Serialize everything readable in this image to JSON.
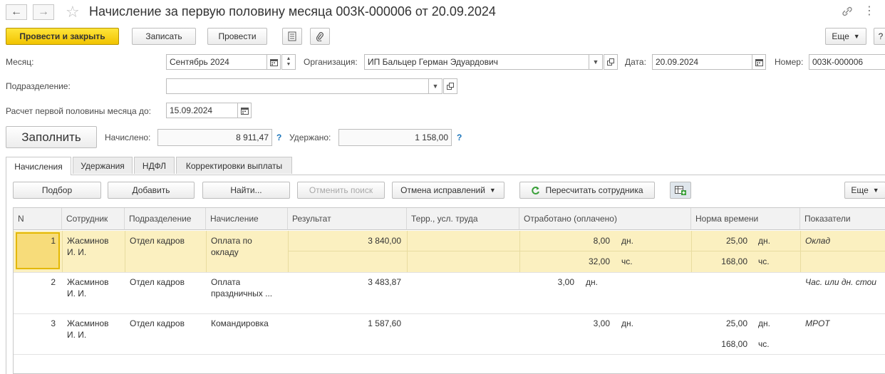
{
  "header": {
    "title": "Начисление за первую половину месяца 003К-000006 от 20.09.2024",
    "nav_back": "←",
    "nav_forward": "→",
    "star": "☆",
    "link": "🔗",
    "more_vert": "⋮"
  },
  "toolbar": {
    "post_close": "Провести и закрыть",
    "save": "Записать",
    "post": "Провести",
    "more": "Еще",
    "help": "?"
  },
  "form": {
    "month_label": "Месяц:",
    "month_value": "Сентябрь 2024",
    "org_label": "Организация:",
    "org_value": "ИП Бальцер Герман Эдуардович",
    "date_label": "Дата:",
    "date_value": "20.09.2024",
    "number_label": "Номер:",
    "number_value": "003К-000006",
    "dept_label": "Подразделение:",
    "dept_value": "",
    "calc_until_label": "Расчет первой половины месяца до:",
    "calc_until_value": "15.09.2024",
    "fill_button": "Заполнить",
    "accrued_label": "Начислено:",
    "accrued_value": "8 911,47",
    "withheld_label": "Удержано:",
    "withheld_value": "1 158,00",
    "help_mark": "?"
  },
  "tabs": [
    {
      "label": "Начисления",
      "active": true
    },
    {
      "label": "Удержания",
      "active": false
    },
    {
      "label": "НДФЛ",
      "active": false
    },
    {
      "label": "Корректировки выплаты",
      "active": false
    }
  ],
  "table_toolbar": {
    "select": "Подбор",
    "add": "Добавить",
    "find": "Найти...",
    "cancel_search": "Отменить поиск",
    "cancel_corrections": "Отмена исправлений",
    "recalc_employee": "Пересчитать сотрудника",
    "more": "Еще"
  },
  "table": {
    "columns": [
      "N",
      "Сотрудник",
      "Подразделение",
      "Начисление",
      "Результат",
      "Терр., усл. труда",
      "Отработано (оплачено)",
      "Норма времени",
      "Показатели"
    ],
    "rows": [
      {
        "n": "1",
        "employee": [
          "Жасминов",
          "И. И."
        ],
        "dept": "Отдел кадров",
        "accrual": [
          "Оплата по",
          "окладу"
        ],
        "result": "3 840,00",
        "worked": [
          {
            "value": "8,00",
            "unit": "дн."
          },
          {
            "value": "32,00",
            "unit": "чс."
          }
        ],
        "norm": [
          {
            "value": "25,00",
            "unit": "дн."
          },
          {
            "value": "168,00",
            "unit": "чс."
          }
        ],
        "indicator": "Оклад"
      },
      {
        "n": "2",
        "employee": [
          "Жасминов",
          "И. И."
        ],
        "dept": "Отдел кадров",
        "accrual": [
          "Оплата",
          "праздничных ..."
        ],
        "result": "3 483,87",
        "worked": [
          {
            "value": "3,00",
            "unit": "дн."
          }
        ],
        "norm": [],
        "indicator": "Час. или дн. стои"
      },
      {
        "n": "3",
        "employee": [
          "Жасминов",
          "И. И."
        ],
        "dept": "Отдел кадров",
        "accrual": [
          "Командировка",
          ""
        ],
        "result": "1 587,60",
        "worked": [
          {
            "value": "3,00",
            "unit": "дн."
          }
        ],
        "norm": [
          {
            "value": "25,00",
            "unit": "дн."
          },
          {
            "value": "168,00",
            "unit": "чс."
          }
        ],
        "indicator": "МРОТ"
      }
    ]
  },
  "colors": {
    "primary_button": "#f5cd0e",
    "selected_row": "#fbf0c0",
    "selected_cell": "#f7dc7a",
    "accent_blue": "#1b75bb",
    "recalc_green": "#3aa03a"
  }
}
